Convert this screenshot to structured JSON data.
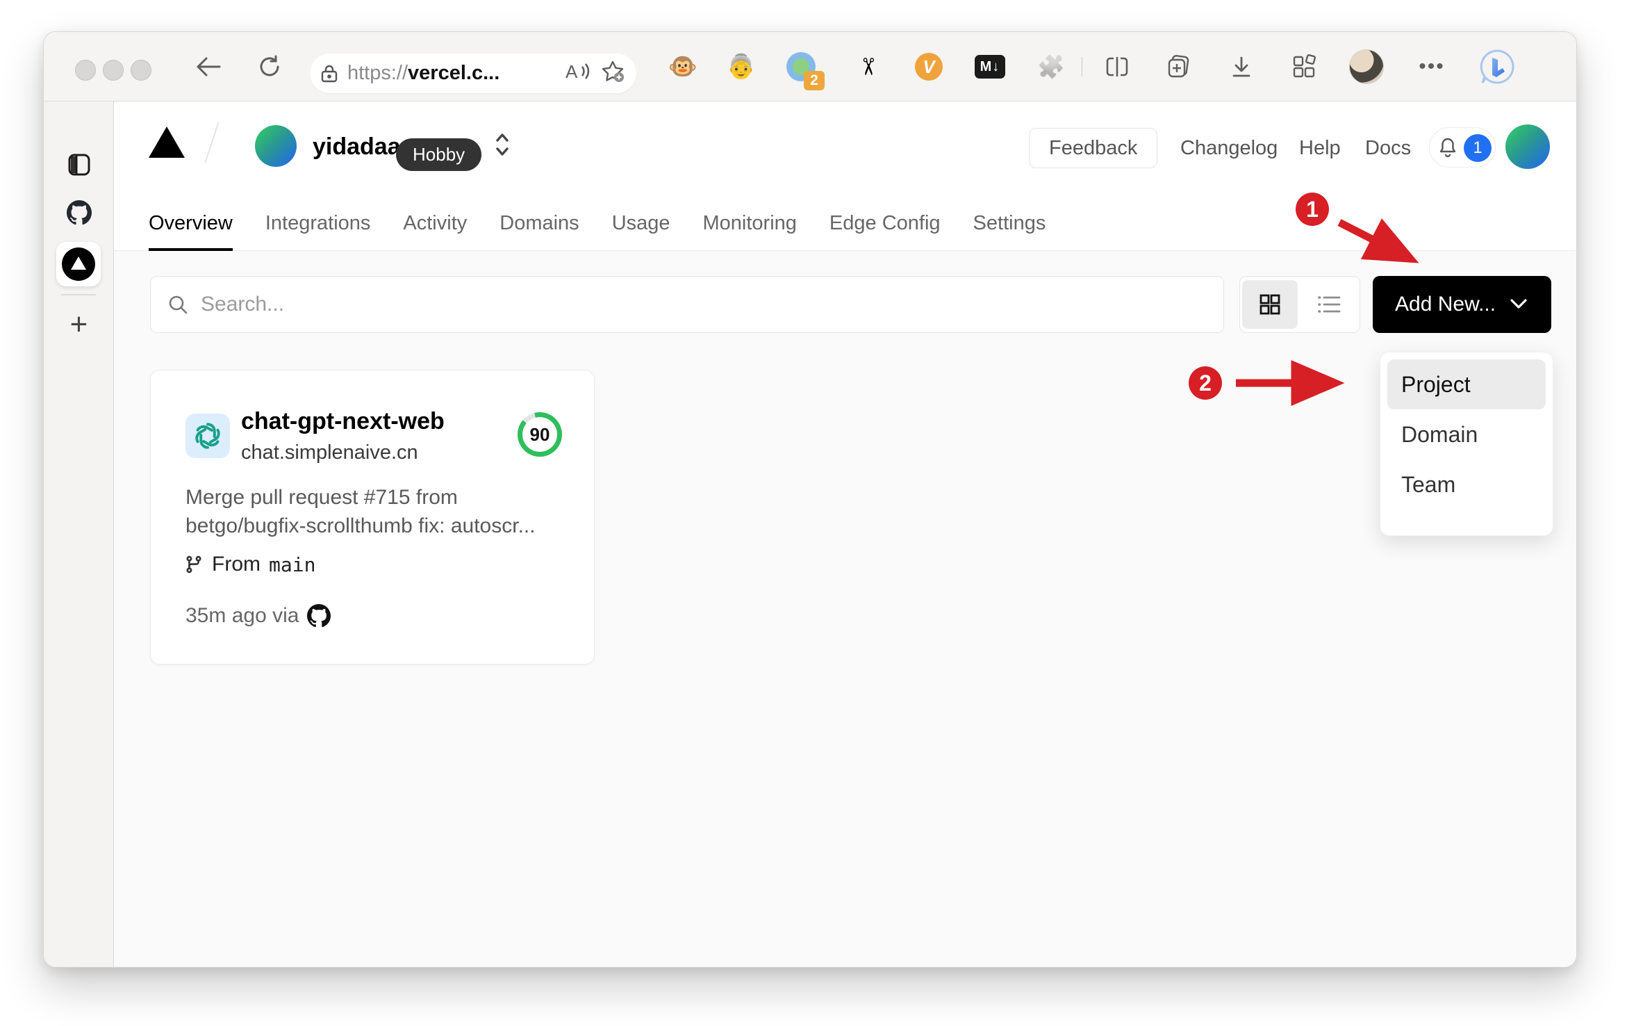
{
  "browser": {
    "url": {
      "scheme": "https://",
      "host": "vercel.c..."
    },
    "extensions": {
      "tampermonkey_glyph": "🐵",
      "persona_glyph": "👵",
      "proxy_badge": "2",
      "scissors_glyph": "✂",
      "v_glyph": "V",
      "markdown_glyph": "M↓",
      "puzzle_glyph": "🧩",
      "more_glyph": "•••"
    },
    "sidebar": {
      "new_tab_glyph": "+"
    }
  },
  "vercel": {
    "header": {
      "team": "yidadaa",
      "plan": "Hobby",
      "feedback": "Feedback",
      "links": {
        "0": "Changelog",
        "1": "Help",
        "2": "Docs"
      },
      "notification_count": "1"
    },
    "tabs": {
      "items": {
        "0": "Overview",
        "1": "Integrations",
        "2": "Activity",
        "3": "Domains",
        "4": "Usage",
        "5": "Monitoring",
        "6": "Edge Config",
        "7": "Settings"
      }
    },
    "toolbar": {
      "search_placeholder": "Search...",
      "add_new": "Add New..."
    },
    "project_card": {
      "name": "chat-gpt-next-web",
      "domain": "chat.simplenaive.cn",
      "score": "90",
      "commit_line1": "Merge pull request #715 from",
      "commit_line2": "betgo/bugfix-scrollthumb fix: autoscr...",
      "from_label": "From",
      "branch": "main",
      "deployed": "35m ago via"
    },
    "dropdown": {
      "items": {
        "0": "Project",
        "1": "Domain",
        "2": "Team"
      }
    }
  },
  "annotations": {
    "step1": "1",
    "step2": "2",
    "accent": "#d71f26"
  },
  "colors": {
    "accent_blue": "#2170f3",
    "success_green": "#2fbe5c",
    "button_black": "#000000",
    "annotation_red": "#d71f26"
  }
}
